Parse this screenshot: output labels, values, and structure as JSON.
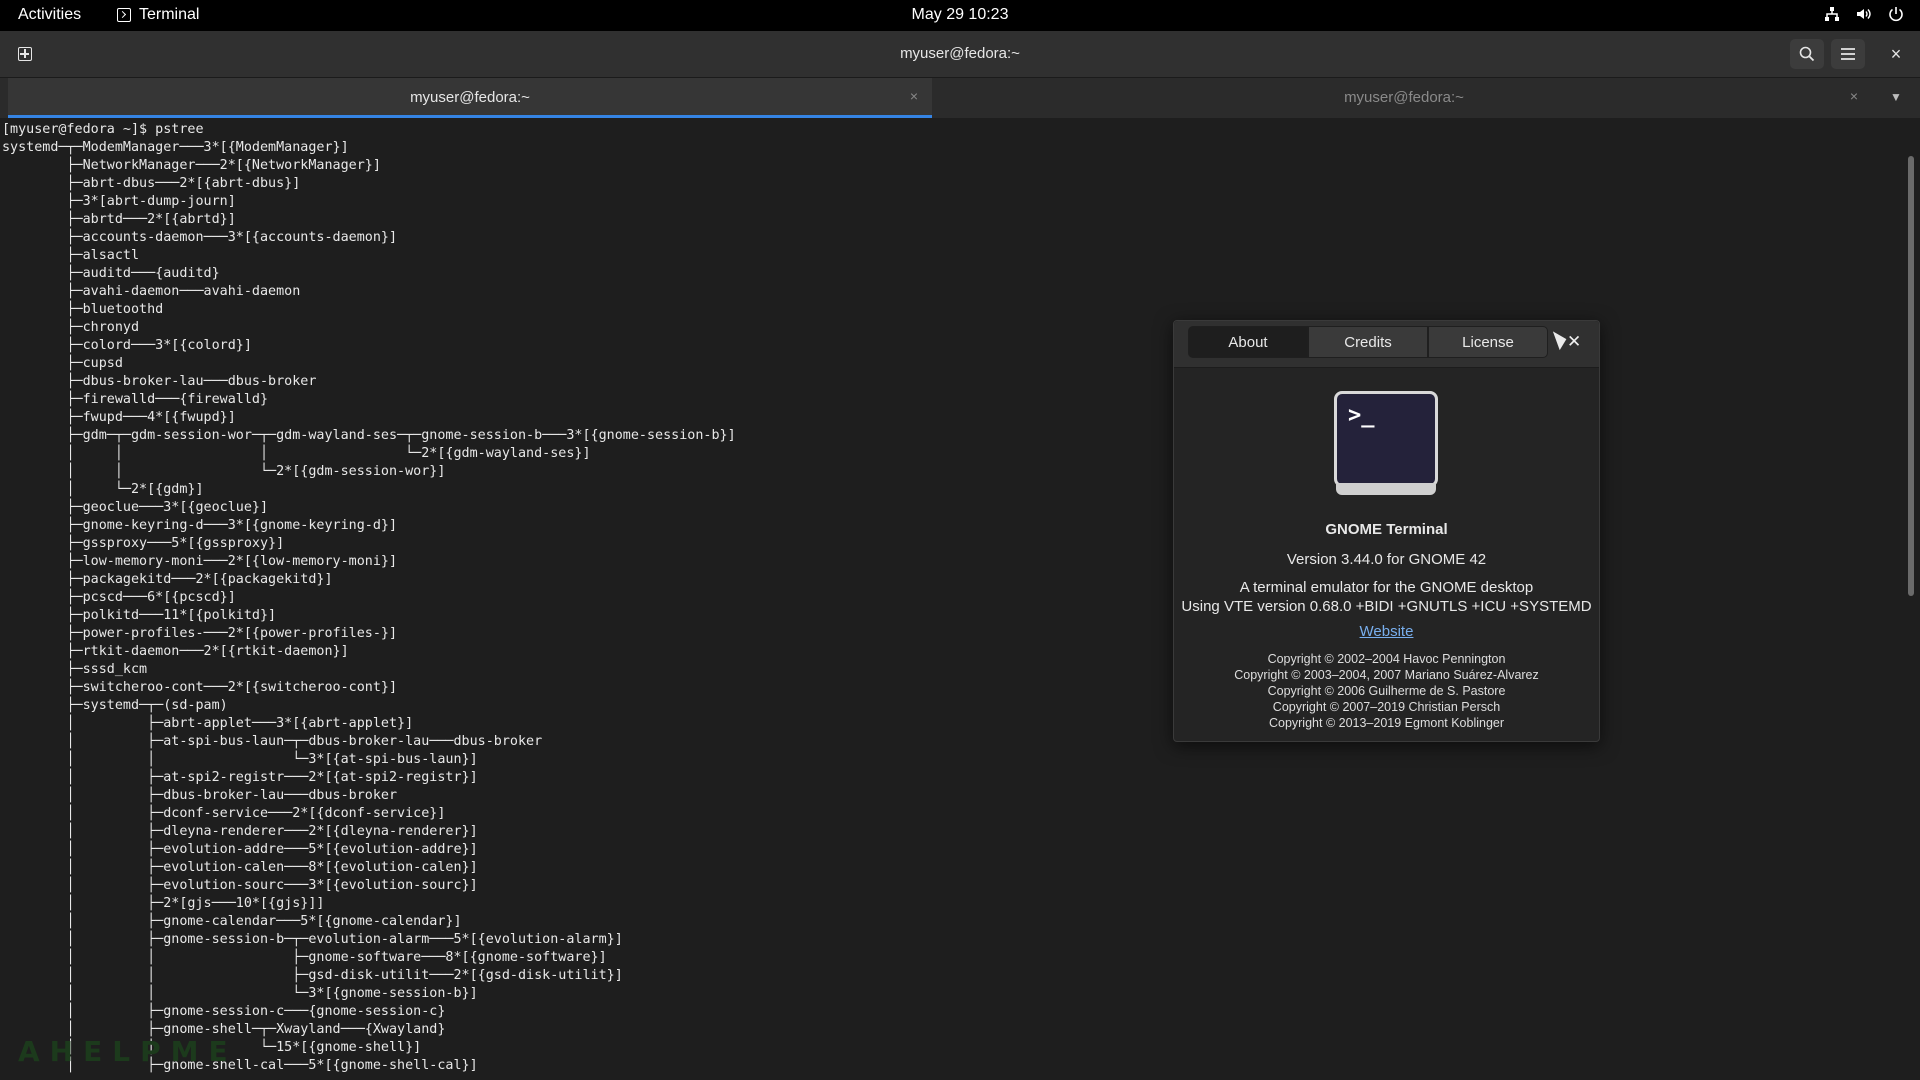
{
  "topbar": {
    "activities": "Activities",
    "app_name": "Terminal",
    "clock": "May 29  10:23"
  },
  "window": {
    "title": "myuser@fedora:~",
    "tabs": [
      {
        "label": "myuser@fedora:~",
        "active": true
      },
      {
        "label": "myuser@fedora:~",
        "active": false
      }
    ]
  },
  "terminal": {
    "output": "[myuser@fedora ~]$ pstree\nsystemd─┬─ModemManager───3*[{ModemManager}]\n        ├─NetworkManager───2*[{NetworkManager}]\n        ├─abrt-dbus───2*[{abrt-dbus}]\n        ├─3*[abrt-dump-journ]\n        ├─abrtd───2*[{abrtd}]\n        ├─accounts-daemon───3*[{accounts-daemon}]\n        ├─alsactl\n        ├─auditd───{auditd}\n        ├─avahi-daemon───avahi-daemon\n        ├─bluetoothd\n        ├─chronyd\n        ├─colord───3*[{colord}]\n        ├─cupsd\n        ├─dbus-broker-lau───dbus-broker\n        ├─firewalld───{firewalld}\n        ├─fwupd───4*[{fwupd}]\n        ├─gdm─┬─gdm-session-wor─┬─gdm-wayland-ses─┬─gnome-session-b───3*[{gnome-session-b}]\n        │     │                 │                 └─2*[{gdm-wayland-ses}]\n        │     │                 └─2*[{gdm-session-wor}]\n        │     └─2*[{gdm}]\n        ├─geoclue───3*[{geoclue}]\n        ├─gnome-keyring-d───3*[{gnome-keyring-d}]\n        ├─gssproxy───5*[{gssproxy}]\n        ├─low-memory-moni───2*[{low-memory-moni}]\n        ├─packagekitd───2*[{packagekitd}]\n        ├─pcscd───6*[{pcscd}]\n        ├─polkitd───11*[{polkitd}]\n        ├─power-profiles-───2*[{power-profiles-}]\n        ├─rtkit-daemon───2*[{rtkit-daemon}]\n        ├─sssd_kcm\n        ├─switcheroo-cont───2*[{switcheroo-cont}]\n        ├─systemd─┬─(sd-pam)\n        │         ├─abrt-applet───3*[{abrt-applet}]\n        │         ├─at-spi-bus-laun─┬─dbus-broker-lau───dbus-broker\n        │         │                 └─3*[{at-spi-bus-laun}]\n        │         ├─at-spi2-registr───2*[{at-spi2-registr}]\n        │         ├─dbus-broker-lau───dbus-broker\n        │         ├─dconf-service───2*[{dconf-service}]\n        │         ├─dleyna-renderer───2*[{dleyna-renderer}]\n        │         ├─evolution-addre───5*[{evolution-addre}]\n        │         ├─evolution-calen───8*[{evolution-calen}]\n        │         ├─evolution-sourc───3*[{evolution-sourc}]\n        │         ├─2*[gjs───10*[{gjs}]]\n        │         ├─gnome-calendar───5*[{gnome-calendar}]\n        │         ├─gnome-session-b─┬─evolution-alarm───5*[{evolution-alarm}]\n        │         │                 ├─gnome-software───8*[{gnome-software}]\n        │         │                 ├─gsd-disk-utilit───2*[{gsd-disk-utilit}]\n        │         │                 └─3*[{gnome-session-b}]\n        │         ├─gnome-session-c───{gnome-session-c}\n        │         ├─gnome-shell─┬─Xwayland───{Xwayland}\n        │         │             └─15*[{gnome-shell}]\n        │         ├─gnome-shell-cal───5*[{gnome-shell-cal}]"
  },
  "watermark": "AHELPME",
  "about_dialog": {
    "tabs": [
      "About",
      "Credits",
      "License"
    ],
    "logo_prompt": ">_",
    "app_name": "GNOME Terminal",
    "version": "Version 3.44.0 for GNOME 42",
    "description_1": "A terminal emulator for the GNOME desktop",
    "description_2": "Using VTE version 0.68.0 +BIDI +GNUTLS +ICU +SYSTEMD",
    "website": "Website",
    "copyrights": [
      "Copyright © 2002–2004 Havoc Pennington",
      "Copyright © 2003–2004, 2007 Mariano Suárez-Alvarez",
      "Copyright © 2006 Guilherme de S. Pastore",
      "Copyright © 2007–2019 Christian Persch",
      "Copyright © 2013–2019 Egmont Koblinger"
    ]
  }
}
